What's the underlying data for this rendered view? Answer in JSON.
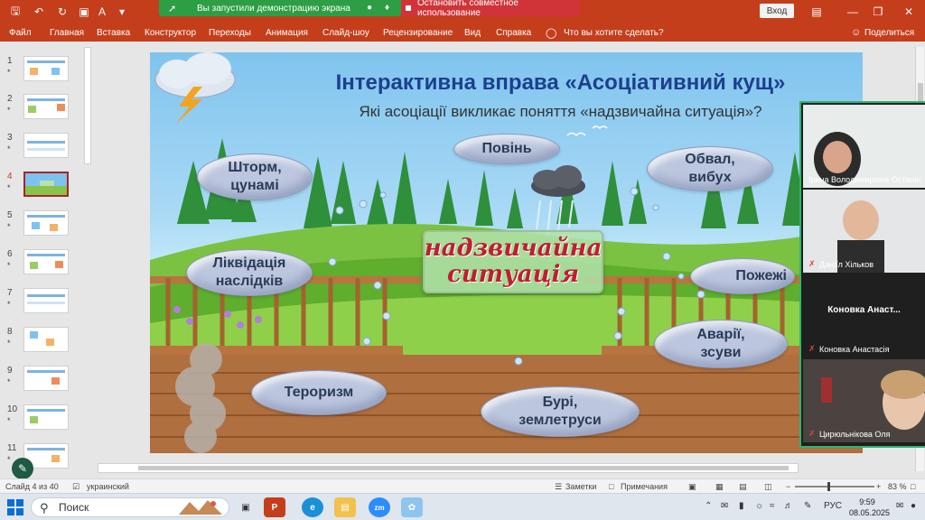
{
  "titlebar": {
    "share_status": "Вы запустили демонстрацию экрана",
    "stop_share": "Остановить совместное использование",
    "login": "Вход"
  },
  "ribbon": {
    "tabs": [
      "Файл",
      "Главная",
      "Вставка",
      "Конструктор",
      "Переходы",
      "Анимация",
      "Слайд-шоу",
      "Рецензирование",
      "Вид",
      "Справка"
    ],
    "tell_me": "Что вы хотите сделать?",
    "share": "Поделиться"
  },
  "thumbnails": [
    {
      "num": "1",
      "star": "*"
    },
    {
      "num": "2",
      "star": "*"
    },
    {
      "num": "3",
      "star": "*"
    },
    {
      "num": "4",
      "star": "*"
    },
    {
      "num": "5",
      "star": "*"
    },
    {
      "num": "6",
      "star": "*"
    },
    {
      "num": "7",
      "star": "*"
    },
    {
      "num": "8",
      "star": "*"
    },
    {
      "num": "9",
      "star": "*"
    },
    {
      "num": "10",
      "star": "*"
    },
    {
      "num": "11",
      "star": "*"
    }
  ],
  "slide": {
    "title": "Інтерактивна вправа «Асоціативний кущ»",
    "subtitle": "Які асоціації викликає поняття «надзвичайна ситуація»?",
    "center_line1": "надзвичайна",
    "center_line2": "ситуація",
    "clouds": {
      "flood": "Повінь",
      "storm_l1": "Шторм,",
      "storm_l2": "цунамі",
      "collapse_l1": "Обвал,",
      "collapse_l2": "вибух",
      "liquidation_l1": "Ліквідація",
      "liquidation_l2": "наслідків",
      "fires": "Пожежі",
      "accidents_l1": "Аварії,",
      "accidents_l2": "зсуви",
      "terrorism": "Тероризм",
      "hurricanes_l1": "Бурі,",
      "hurricanes_l2": "землетруси"
    }
  },
  "video": {
    "p1": "Ірина Володимирівна Останін",
    "p2": "Даніїл Хільков",
    "p3_center": "Коновка Анаст...",
    "p3": "Коновка Анастасія",
    "p4": "Цирюльнікова Оля"
  },
  "status": {
    "slide": "Слайд 4 из 40",
    "lang": "украинский",
    "notes": "Заметки",
    "comments": "Примечания",
    "zoom": "83 %"
  },
  "taskbar": {
    "search": "Поиск",
    "lang": "РУС",
    "time": "9:59",
    "date": "08.05.2025"
  }
}
